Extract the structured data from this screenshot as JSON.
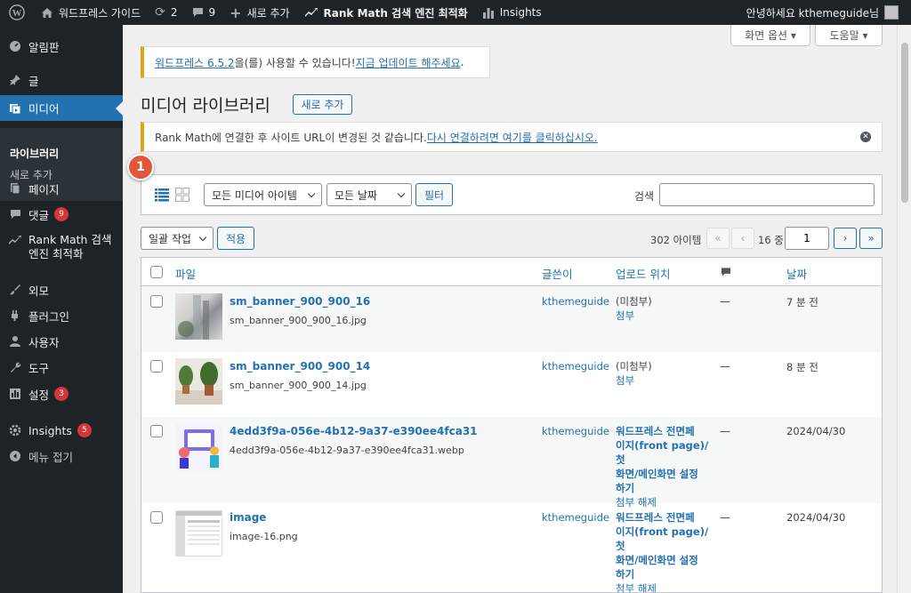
{
  "adminbar": {
    "site_name": "워드프레스 가이드",
    "updates_count": "2",
    "comments_count": "9",
    "new_label": "새로 추가",
    "rankmath_label": "Rank Math 검색 엔진 최적화",
    "insights_label": "Insights",
    "greeting": "안녕하세요 kthemeguide님"
  },
  "sidebar": {
    "dashboard": "알림판",
    "posts": "글",
    "media": "미디어",
    "media_sub_library": "라이브러리",
    "media_sub_add": "새로 추가",
    "pages": "페이지",
    "comments": "댓글",
    "comments_badge": "9",
    "rankmath_line1": "Rank Math 검색",
    "rankmath_line2": "엔진 최적화",
    "appearance": "외모",
    "plugins": "플러그인",
    "users": "사용자",
    "tools": "도구",
    "settings": "설정",
    "settings_badge": "3",
    "insights": "Insights",
    "insights_badge": "5",
    "collapse": "메뉴 접기"
  },
  "top": {
    "screen_options": "화면 옵션 ▾",
    "help": "도움말 ▾"
  },
  "update_notice": {
    "link1": "워드프레스 6.5.2",
    "text": "을(를) 사용할 수 있습니다! ",
    "link2": "지금 업데이트 해주세요",
    "end": "."
  },
  "page": {
    "title": "미디어 라이브러리",
    "add_new": "새로 추가"
  },
  "rankmath_notice": {
    "text": "Rank Math에 연결한 후 사이트 URL이 변경된 것 같습니다. ",
    "link": "다시 연결하려면 여기를 클릭하십시오."
  },
  "step_number": "1",
  "filters": {
    "media_type": "모든 미디어 아이템",
    "dates": "모든 날짜",
    "filter_button": "필터",
    "search_label": "검색",
    "search_value": ""
  },
  "bulk": {
    "action": "일괄 작업",
    "apply": "적용"
  },
  "pagination": {
    "items": "302 아이템",
    "first": "«",
    "prev": "‹",
    "current": "1",
    "of_total": "16 중",
    "next": "›",
    "last": "»"
  },
  "table": {
    "headers": {
      "file": "파일",
      "author": "글쓴이",
      "uploaded_to": "업로드 위치",
      "date": "날짜"
    },
    "rows": [
      {
        "title": "sm_banner_900_900_16",
        "filename": "sm_banner_900_900_16.jpg",
        "author": "kthemeguide",
        "uploaded_line1": "(미첨부)",
        "uploaded_link": "첨부",
        "comments": "—",
        "date": "7 분 전"
      },
      {
        "title": "sm_banner_900_900_14",
        "filename": "sm_banner_900_900_14.jpg",
        "author": "kthemeguide",
        "uploaded_line1": "(미첨부)",
        "uploaded_link": "첨부",
        "comments": "—",
        "date": "8 분 전"
      },
      {
        "title": "4edd3f9a-056e-4b12-9a37-e390ee4fca31",
        "filename": "4edd3f9a-056e-4b12-9a37-e390ee4fca31.webp",
        "author": "kthemeguide",
        "uploaded_bold": [
          "워드프레스 전면페",
          "이지(front page)/첫",
          "화면/메인화면 설정",
          "하기"
        ],
        "uploaded_link": "첨부 해제",
        "comments": "—",
        "date": "2024/04/30"
      },
      {
        "title": "image",
        "filename": "image-16.png",
        "author": "kthemeguide",
        "uploaded_bold": [
          "워드프레스 전면페",
          "이지(front page)/첫",
          "화면/메인화면 설정",
          "하기"
        ],
        "uploaded_link": "첨부 해제",
        "comments": "—",
        "date": "2024/04/30"
      }
    ]
  }
}
